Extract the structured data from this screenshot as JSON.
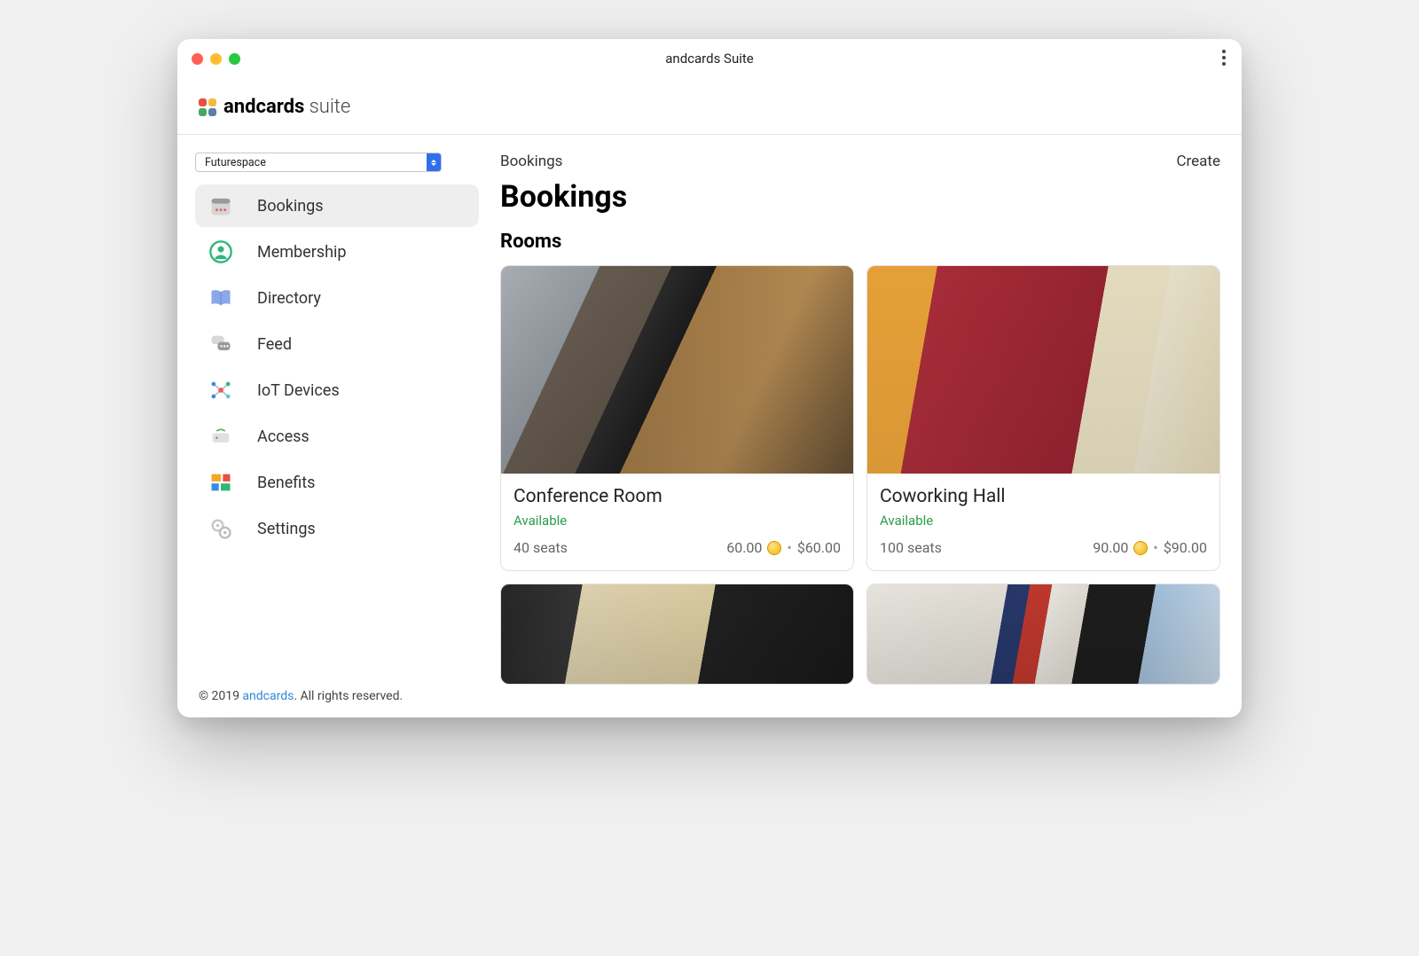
{
  "window_title": "andcards Suite",
  "brand": {
    "name": "andcards",
    "suffix": " suite"
  },
  "space_selector": {
    "value": "Futurespace"
  },
  "sidebar": {
    "items": [
      {
        "label": "Bookings",
        "icon": "calendar",
        "active": true
      },
      {
        "label": "Membership",
        "icon": "person"
      },
      {
        "label": "Directory",
        "icon": "book"
      },
      {
        "label": "Feed",
        "icon": "chat"
      },
      {
        "label": "IoT Devices",
        "icon": "nodes"
      },
      {
        "label": "Access",
        "icon": "router"
      },
      {
        "label": "Benefits",
        "icon": "tiles"
      },
      {
        "label": "Settings",
        "icon": "gear"
      }
    ]
  },
  "footer": {
    "prefix": "© 2019 ",
    "link": "andcards",
    "suffix": ". All rights reserved."
  },
  "main": {
    "breadcrumb": "Bookings",
    "create_label": "Create",
    "page_title": "Bookings",
    "section_title": "Rooms",
    "rooms": [
      {
        "name": "Conference Room",
        "status": "Available",
        "seats": "40 seats",
        "credits": "60.00",
        "price": "$60.00",
        "photo": "conf"
      },
      {
        "name": "Coworking Hall",
        "status": "Available",
        "seats": "100 seats",
        "credits": "90.00",
        "price": "$90.00",
        "photo": "cowork"
      },
      {
        "photo": "r3",
        "partial": true
      },
      {
        "photo": "r4",
        "partial": true
      }
    ]
  }
}
